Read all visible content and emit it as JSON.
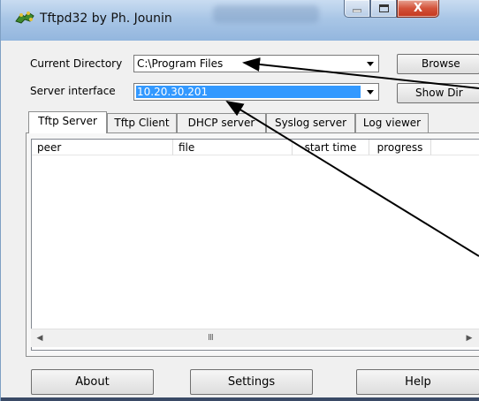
{
  "window": {
    "title": "Tftpd32 by Ph. Jounin",
    "minimize_label": "–",
    "maximize_label": "□",
    "close_label": "X"
  },
  "current_directory": {
    "label": "Current Directory",
    "value": "C:\\Program Files",
    "browse_label": "Browse"
  },
  "server_interface": {
    "label": "Server interface",
    "value": "10.20.30.201",
    "show_dir_label": "Show Dir"
  },
  "tabs": [
    {
      "label": "Tftp Server",
      "active": true
    },
    {
      "label": "Tftp Client",
      "active": false
    },
    {
      "label": "DHCP server",
      "active": false
    },
    {
      "label": "Syslog server",
      "active": false
    },
    {
      "label": "Log viewer",
      "active": false
    }
  ],
  "table": {
    "columns": [
      "peer",
      "file",
      "start time",
      "progress"
    ],
    "rows": []
  },
  "scrollbar": {
    "thumb_grip": "III",
    "left_arrow": "◀",
    "right_arrow": "▶"
  },
  "buttons": {
    "about": "About",
    "settings": "Settings",
    "help": "Help"
  },
  "colors": {
    "selection": "#3399ff",
    "title_gradient": "#a9c6e6",
    "close_button": "#c4371d"
  },
  "icons": [
    "tftpd-app-icon",
    "minimize-icon",
    "maximize-icon",
    "close-icon",
    "chevron-down-icon",
    "arrow-annotation"
  ]
}
